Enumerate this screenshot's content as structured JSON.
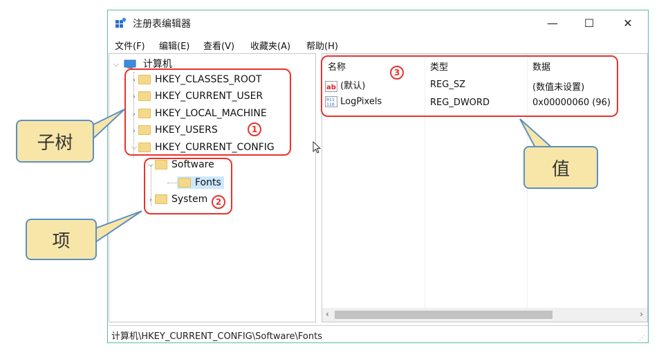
{
  "window": {
    "title": "注册表编辑器",
    "controls": {
      "minimize": "—",
      "maximize": "☐",
      "close": "✕"
    }
  },
  "menu": [
    "文件(F)",
    "编辑(E)",
    "查看(V)",
    "收藏夹(A)",
    "帮助(H)"
  ],
  "tree": {
    "root": "计算机",
    "hives": [
      "HKEY_CLASSES_ROOT",
      "HKEY_CURRENT_USER",
      "HKEY_LOCAL_MACHINE",
      "HKEY_USERS",
      "HKEY_CURRENT_CONFIG"
    ],
    "items": [
      "Software",
      "Fonts",
      "System"
    ]
  },
  "values": {
    "columns": [
      "名称",
      "类型",
      "数据"
    ],
    "rows": [
      {
        "name": "(默认)",
        "type": "REG_SZ",
        "data": "(数值未设置)",
        "icon": "string-value-icon"
      },
      {
        "name": "LogPixels",
        "type": "REG_DWORD",
        "data": "0x00000060 (96)",
        "icon": "binary-value-icon"
      }
    ]
  },
  "status": "计算机\\HKEY_CURRENT_CONFIG\\Software\\Fonts",
  "annotations": {
    "badges": [
      "1",
      "2",
      "3"
    ],
    "callouts": {
      "subtree": "子树",
      "item": "项",
      "value": "值"
    }
  },
  "colors": {
    "highlight": "#e8322d",
    "callout_fill": "#f7e6a8",
    "callout_border": "#5c8fc2",
    "selected": "#cce8ff"
  }
}
